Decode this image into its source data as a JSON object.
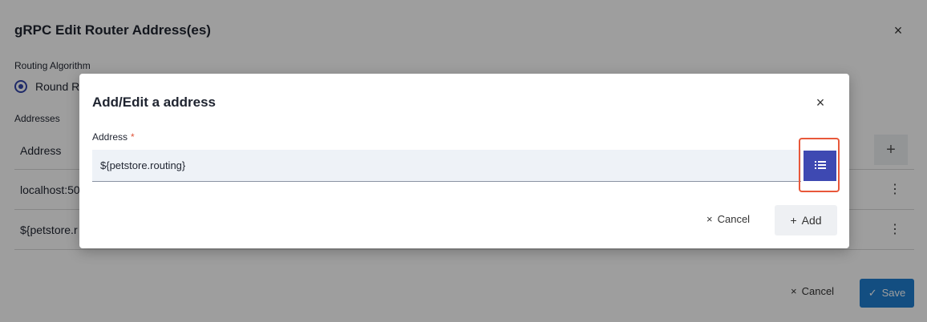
{
  "outer": {
    "title": "gRPC Edit Router Address(es)",
    "close_icon": "×",
    "routing_label": "Routing Algorithm",
    "routing_option": "Round R",
    "addresses_label": "Addresses",
    "table_header": "Address",
    "add_icon": "+",
    "rows": [
      {
        "address": "localhost:50"
      },
      {
        "address": "${petstore.r"
      }
    ],
    "menu_icon": "⋮",
    "cancel_label": "Cancel",
    "save_label": "Save"
  },
  "dialog": {
    "title": "Add/Edit a address",
    "close_icon": "×",
    "address_label": "Address",
    "required_mark": "*",
    "address_value": "${petstore.routing}",
    "cancel_icon": "×",
    "cancel_label": "Cancel",
    "add_icon": "+",
    "add_label": "Add"
  },
  "colors": {
    "accent": "#3e49b2",
    "highlight": "#e8583a",
    "save": "#1f7fd1"
  }
}
